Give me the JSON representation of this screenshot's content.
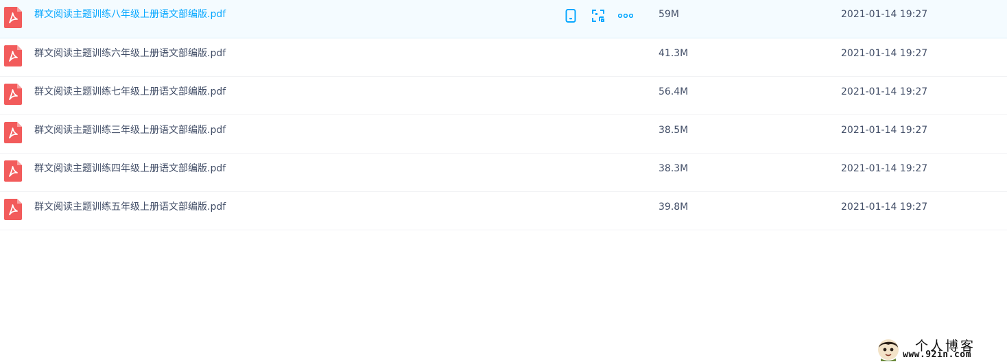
{
  "files": [
    {
      "name": "群文阅读主题训练八年级上册语文部编版.pdf",
      "size": "59M",
      "date": "2021-01-14 19:27",
      "selected": true
    },
    {
      "name": "群文阅读主题训练六年级上册语文部编版.pdf",
      "size": "41.3M",
      "date": "2021-01-14 19:27",
      "selected": false
    },
    {
      "name": "群文阅读主题训练七年级上册语文部编版.pdf",
      "size": "56.4M",
      "date": "2021-01-14 19:27",
      "selected": false
    },
    {
      "name": "群文阅读主题训练三年级上册语文部编版.pdf",
      "size": "38.5M",
      "date": "2021-01-14 19:27",
      "selected": false
    },
    {
      "name": "群文阅读主题训练四年级上册语文部编版.pdf",
      "size": "38.3M",
      "date": "2021-01-14 19:27",
      "selected": false
    },
    {
      "name": "群文阅读主题训练五年级上册语文部编版.pdf",
      "size": "39.8M",
      "date": "2021-01-14 19:27",
      "selected": false
    }
  ],
  "row_actions": [
    "phone-icon",
    "qr-scan-icon",
    "more-icon"
  ],
  "watermark": {
    "title": "个人博客",
    "url": "www.92in.com"
  },
  "colors": {
    "accent": "#06a7ff",
    "pdf_red": "#f25b5b",
    "text": "#424e67",
    "selected_bg": "#f4fbff"
  }
}
